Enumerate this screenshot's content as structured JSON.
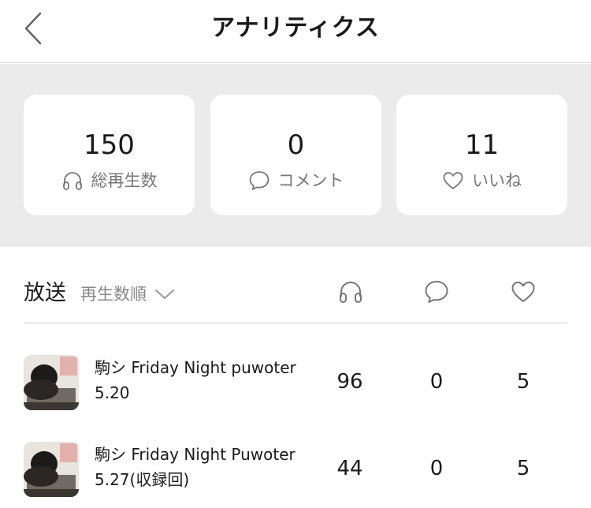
{
  "header": {
    "title": "アナリティクス",
    "back_icon": "chevron-left-icon"
  },
  "stats": [
    {
      "value": "150",
      "label": "総再生数",
      "icon": "headphones-icon"
    },
    {
      "value": "0",
      "label": "コメント",
      "icon": "comment-bubble-icon"
    },
    {
      "value": "11",
      "label": "いいね",
      "icon": "heart-icon"
    }
  ],
  "list": {
    "section_title": "放送",
    "sort_label": "再生数順",
    "sort_icon": "chevron-down-icon",
    "column_icons": [
      "headphones-icon",
      "comment-bubble-icon",
      "heart-icon"
    ],
    "rows": [
      {
        "title": "駒シ Friday Night puwoter 5.20",
        "plays": "96",
        "comments": "0",
        "likes": "5"
      },
      {
        "title": "駒シ  Friday Night Puwoter 5.27(収録回)",
        "plays": "44",
        "comments": "0",
        "likes": "5"
      }
    ]
  },
  "colors": {
    "band_background": "#ebebeb",
    "card_background": "#ffffff",
    "text_primary": "#1a1a1a",
    "text_secondary": "#777777",
    "icon_gray": "#777777"
  }
}
